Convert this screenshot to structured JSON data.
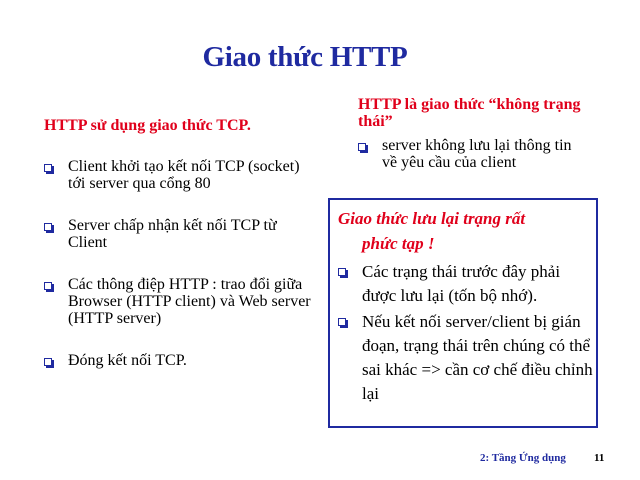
{
  "slide": {
    "title": "Giao thức HTTP"
  },
  "left": {
    "heading": "HTTP sử dụng giao thức TCP.",
    "items": [
      {
        "text": "Client khởi tạo kết nối TCP (socket) tới server qua cổng 80"
      },
      {
        "text": "Server chấp nhận kết nối TCP từ Client"
      },
      {
        "text": "Các thông điệp HTTP : trao đổi giữa Browser (HTTP client) và Web server (HTTP server)"
      },
      {
        "text": "Đóng kết nối TCP."
      }
    ]
  },
  "right": {
    "heading": "HTTP là giao thức “không trạng thái”",
    "items": [
      {
        "text": "server không lưu lại thông tin về yêu cầu của client"
      }
    ]
  },
  "stateful_box": {
    "heading_line1": "Giao thức lưu lại trạng rất",
    "heading_line2": "phức tạp !",
    "items": [
      {
        "text": "Các trạng thái trước đây phải được lưu lại (tốn bộ nhớ)."
      },
      {
        "text": "Nếu kết nối server/client bị gián đoạn, trạng thái trên chúng có thể sai khác => cần cơ chế điều chỉnh lại"
      }
    ]
  },
  "footer": {
    "chapter": "2: Tầng Ứng dụng",
    "page_number": "11"
  },
  "colors": {
    "title": "#1f2aa0",
    "heading_red": "#e0001b",
    "box_border": "#1f2aa0"
  },
  "icons": {
    "bullet": "square-bullet-icon"
  }
}
